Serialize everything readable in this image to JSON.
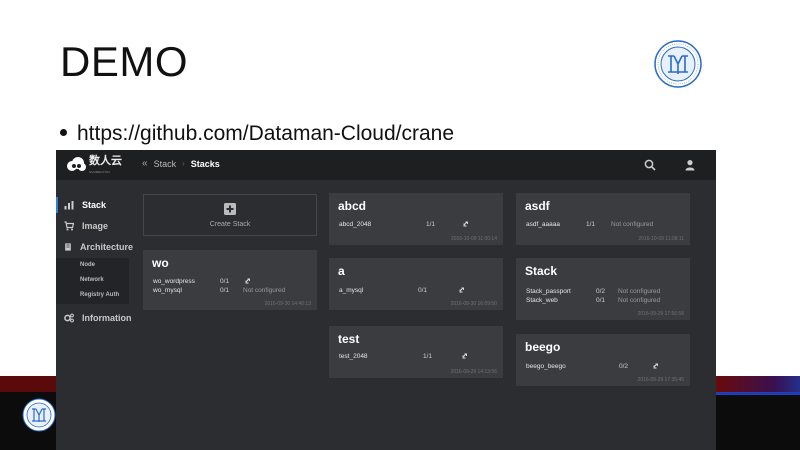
{
  "slide": {
    "title": "DEMO",
    "bullet": "https://github.com/Dataman-Cloud/crane"
  },
  "app": {
    "logo": {
      "cn": "数人云",
      "en": "SHURENYUN"
    },
    "breadcrumb": {
      "parent": "Stack",
      "current": "Stacks"
    },
    "sidebar": {
      "items": [
        {
          "label": "Stack",
          "icon": "stack-icon"
        },
        {
          "label": "Image",
          "icon": "cart-icon"
        },
        {
          "label": "Architecture",
          "icon": "server-icon"
        },
        {
          "label": "Information",
          "icon": "gears-icon"
        }
      ],
      "subitems": [
        "Node",
        "Network",
        "Registry Auth"
      ]
    },
    "create_stack": {
      "label": "Create Stack"
    },
    "stacks": [
      {
        "name": "abcd",
        "time": "2016-10-09 11:00:14",
        "services": [
          {
            "name": "abcd_2048",
            "count": "1/1",
            "status": ""
          }
        ]
      },
      {
        "name": "asdf",
        "time": "2016-10-09 11:08:11",
        "services": [
          {
            "name": "asdf_aaaaa",
            "count": "1/1",
            "status": "Not configured"
          }
        ]
      },
      {
        "name": "wo",
        "time": "2016-09-30 14:40:13",
        "services": [
          {
            "name": "wo_wordpress",
            "count": "0/1",
            "status": ""
          },
          {
            "name": "wo_mysql",
            "count": "0/1",
            "status": "Not configured"
          }
        ]
      },
      {
        "name": "a",
        "time": "2016-09-30 16:09:50",
        "services": [
          {
            "name": "a_mysql",
            "count": "0/1",
            "status": ""
          }
        ]
      },
      {
        "name": "Stack",
        "time": "2016-09-29 17:56:58",
        "services": [
          {
            "name": "Stack_passport",
            "count": "0/2",
            "status": "Not configured"
          },
          {
            "name": "Stack_web",
            "count": "0/1",
            "status": "Not configured"
          }
        ]
      },
      {
        "name": "test",
        "time": "2016-09-29 14:13:56",
        "services": [
          {
            "name": "test_2048",
            "count": "1/1",
            "status": ""
          }
        ]
      },
      {
        "name": "beego",
        "time": "2016-09-29 17:35:45",
        "services": [
          {
            "name": "beego_beego",
            "count": "0/2",
            "status": ""
          }
        ]
      }
    ]
  }
}
